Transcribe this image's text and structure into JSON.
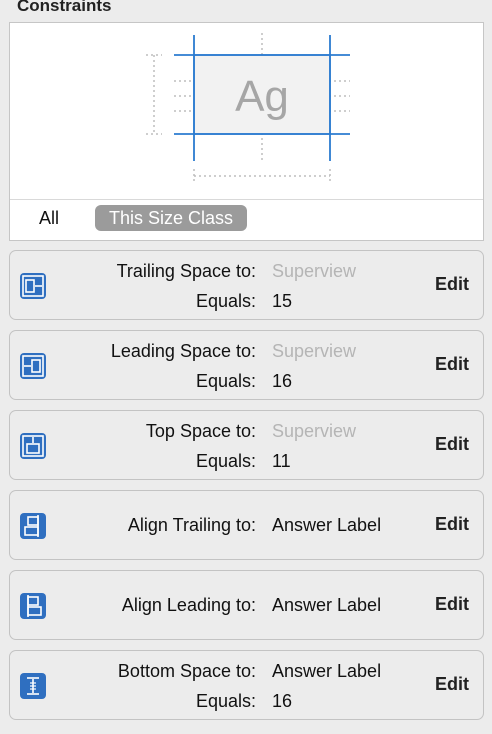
{
  "section_title": "Constraints",
  "preview": {
    "sample_text": "Ag",
    "tabs": {
      "all": "All",
      "size_class": "This Size Class"
    },
    "accent_color": "#2b7bd0"
  },
  "constraints": [
    {
      "icon": "trailing-space-icon",
      "label": "Trailing Space to:",
      "target": "Superview",
      "equals_label": "Equals:",
      "value": "15",
      "edit": "Edit"
    },
    {
      "icon": "leading-space-icon",
      "label": "Leading Space to:",
      "target": "Superview",
      "equals_label": "Equals:",
      "value": "16",
      "edit": "Edit"
    },
    {
      "icon": "top-space-icon",
      "label": "Top Space to:",
      "target": "Superview",
      "equals_label": "Equals:",
      "value": "11",
      "edit": "Edit"
    },
    {
      "icon": "align-trailing-icon",
      "label": "Align Trailing to:",
      "target": "Answer Label",
      "edit": "Edit"
    },
    {
      "icon": "align-leading-icon",
      "label": "Align Leading to:",
      "target": "Answer Label",
      "edit": "Edit"
    },
    {
      "icon": "bottom-space-icon",
      "label": "Bottom Space to:",
      "target": "Answer Label",
      "equals_label": "Equals:",
      "value": "16",
      "edit": "Edit"
    }
  ]
}
